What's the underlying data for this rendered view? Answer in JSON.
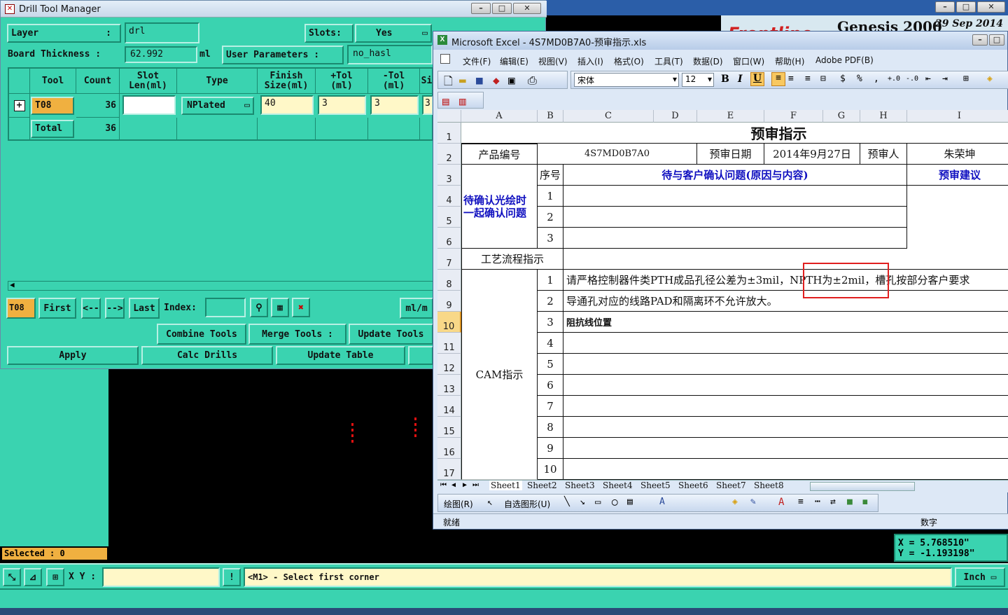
{
  "genesis": {
    "title": "Genesis 2000",
    "date": "29 Sep 2014",
    "coords": {
      "x": "X  =  5.768510\"",
      "y": "Y  =  -1.193198\""
    },
    "selected": "Selected : 0",
    "xy_label": "X Y :",
    "status_msg": "<M1> - Select first corner",
    "unit": "Inch",
    "brand": "Frontline"
  },
  "dtm": {
    "title": "Drill Tool Manager",
    "layer_label": "Layer",
    "layer_value": "drl",
    "slots_label": "Slots:",
    "slots_value": "Yes",
    "board_thickness_label": "Board Thickness :",
    "board_thickness_value": "62.992",
    "board_thickness_unit": "ml",
    "user_params_label": "User Parameters :",
    "user_params_value": "no_hasl",
    "headers": [
      "Tool",
      "Count",
      "Slot\nLen(ml)",
      "Type",
      "Finish\nSize(ml)",
      "+Tol\n(ml)",
      "-Tol\n(ml)",
      "Si"
    ],
    "row": {
      "tool": "T08",
      "count": "36",
      "type": "NPlated",
      "finish": "40",
      "ptol": "3",
      "ntol": "3",
      "si": "3"
    },
    "total_label": "Total",
    "total_count": "36",
    "nav": {
      "current": "T08",
      "first": "First",
      "prev": "<--",
      "next": "-->",
      "last": "Last",
      "index": "Index:",
      "unit": "ml/m"
    },
    "buttons": {
      "combine": "Combine Tools",
      "merge": "Merge Tools :",
      "update_tools": "Update Tools",
      "apply": "Apply",
      "calc": "Calc Drills",
      "update_table": "Update Table"
    }
  },
  "excel": {
    "title": "Microsoft Excel - 4S7MD0B7A0-预审指示.xls",
    "menus": [
      "文件(F)",
      "编辑(E)",
      "视图(V)",
      "插入(I)",
      "格式(O)",
      "工具(T)",
      "数据(D)",
      "窗口(W)",
      "帮助(H)",
      "Adobe PDF(B)"
    ],
    "font_name": "宋体",
    "font_size": "12",
    "col_headers": [
      "A",
      "B",
      "C",
      "D",
      "E",
      "F",
      "G",
      "H",
      "I"
    ],
    "rows": [
      "1",
      "2",
      "3",
      "4",
      "5",
      "6",
      "7",
      "8",
      "9",
      "10",
      "11",
      "12",
      "13",
      "14",
      "15",
      "16",
      "17"
    ],
    "sheet_title": "预审指示",
    "product_label": "产品编号",
    "product_no": "4S7MD0B7A0",
    "date_label": "预审日期",
    "date_value": "2014年9月27日",
    "reviewer_label": "预审人",
    "reviewer": "朱荣坤",
    "seq_label": "序号",
    "issue_header": "待与客户确认问题(原因与内容)",
    "advice_header": "预审建议",
    "pending_label": "待确认光绘时一起确认问题",
    "pending_nums": [
      "1",
      "2",
      "3"
    ],
    "process_label": "工艺流程指示",
    "cam_label": "CAM指示",
    "cam_nums": [
      "1",
      "2",
      "3",
      "4",
      "5",
      "6",
      "7",
      "8",
      "9",
      "10"
    ],
    "cam_lines": [
      "请严格控制器件类PTH成品孔径公差为±3mil，NPTH为±2mil，槽孔按部分客户要求",
      "导通孔对应的线路PAD和隔离环不允许放大。",
      "阻抗线位置"
    ],
    "sheets": [
      "Sheet1",
      "Sheet2",
      "Sheet3",
      "Sheet4",
      "Sheet5",
      "Sheet6",
      "Sheet7",
      "Sheet8"
    ],
    "draw_label": "绘图(R)",
    "autoshape_label": "自选图形(U)",
    "status_ready": "就绪",
    "status_num": "数字"
  },
  "colors": {
    "teal": "#3ad3b0",
    "highlight": "#e02020",
    "excel_blue": "#1010c0"
  }
}
